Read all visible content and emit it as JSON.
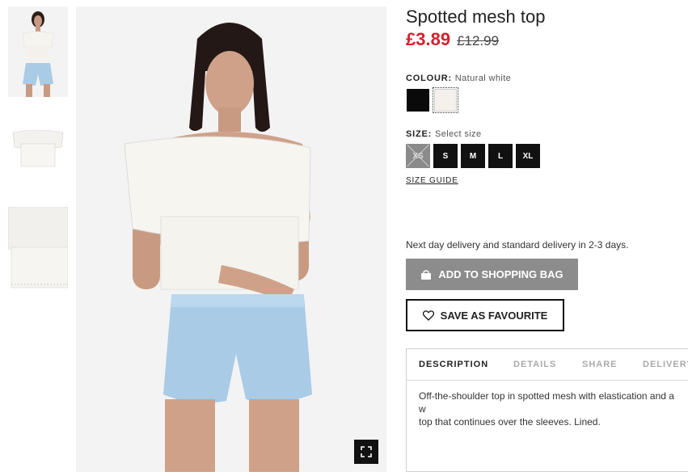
{
  "product": {
    "title": "Spotted mesh top",
    "price_now": "£3.89",
    "price_old": "£12.99"
  },
  "colour": {
    "label": "COLOUR:",
    "selected": "Natural white",
    "swatches": [
      {
        "name": "Black",
        "hex": "#0a0a0a"
      },
      {
        "name": "Natural white",
        "hex": "#f4f1ec"
      }
    ]
  },
  "size": {
    "label": "SIZE:",
    "prompt": "Select size",
    "options": [
      {
        "label": "XS",
        "available": false
      },
      {
        "label": "S",
        "available": true
      },
      {
        "label": "M",
        "available": true
      },
      {
        "label": "L",
        "available": true
      },
      {
        "label": "XL",
        "available": true
      }
    ],
    "guide_label": "SIZE GUIDE"
  },
  "delivery_text": "Next day delivery and standard delivery in 2-3 days.",
  "buttons": {
    "add_to_bag": "ADD TO SHOPPING BAG",
    "save_favourite": "SAVE AS FAVOURITE"
  },
  "tabs": [
    {
      "label": "DESCRIPTION",
      "active": true
    },
    {
      "label": "DETAILS",
      "active": false
    },
    {
      "label": "SHARE",
      "active": false
    },
    {
      "label": "DELIVERY",
      "active": false
    }
  ],
  "description": "Off-the-shoulder top in spotted mesh with elastication and a w\ntop that continues over the sleeves. Lined.",
  "colors": {
    "price_red": "#d6212c",
    "button_grey": "#8c8c8c",
    "shorts_blue": "#a9cbe6"
  },
  "icons": {
    "bag": "shopping-bag-icon",
    "heart": "heart-icon",
    "zoom": "fullscreen-icon"
  }
}
